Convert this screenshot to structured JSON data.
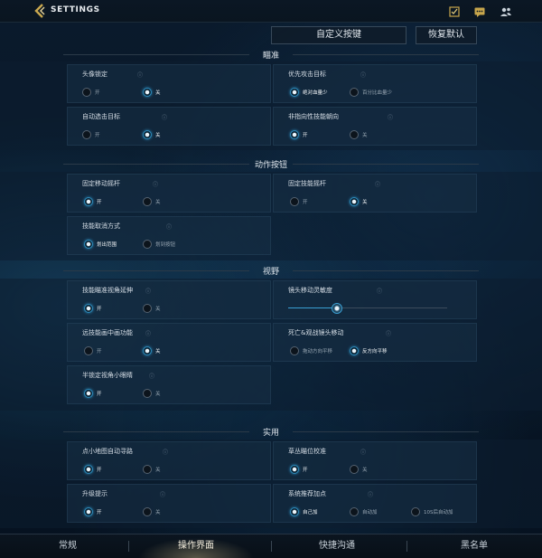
{
  "header": {
    "title": "SETTINGS",
    "icons": [
      "back-arrow-icon",
      "mission-icon",
      "chat-icon",
      "friends-icon"
    ]
  },
  "actions": {
    "custom_keys_label": "自定义按键",
    "reset_default_label": "恢复默认"
  },
  "sections": {
    "aim": {
      "title": "瞄准",
      "items": [
        {
          "label": "头像锁定",
          "options": [
            "开",
            "关"
          ],
          "selected": "关"
        },
        {
          "label": "优先攻击目标",
          "options": [
            "绝对血量少",
            "百分比血量少"
          ],
          "selected": "绝对血量少"
        },
        {
          "label": "自动选击目标",
          "options": [
            "开",
            "关"
          ],
          "selected": "关"
        },
        {
          "label": "非指向性技能朝向",
          "options": [
            "开",
            "关"
          ],
          "selected": "开"
        }
      ]
    },
    "action_buttons": {
      "title": "动作按钮",
      "items": [
        {
          "label": "固定移动摇杆",
          "options": [
            "开",
            "关"
          ],
          "selected": "开"
        },
        {
          "label": "固定技能摇杆",
          "options": [
            "开",
            "关"
          ],
          "selected": "关"
        },
        {
          "label": "技能取消方式",
          "options": [
            "划出范围",
            "划到按钮"
          ],
          "selected": "划出范围"
        }
      ]
    },
    "view": {
      "title": "视野",
      "items": [
        {
          "label": "技能瞄准视角延伸",
          "options": [
            "开",
            "关"
          ],
          "selected": "开"
        },
        {
          "label": "镜头移动灵敏度",
          "slider_value": 0.3
        },
        {
          "label": "远技能画中画功能",
          "options": [
            "开",
            "关"
          ],
          "selected": "关"
        },
        {
          "label": "死亡&观战镜头移动",
          "options": [
            "拖动方向平移",
            "反方向平移"
          ],
          "selected": "反方向平移"
        },
        {
          "label": "半锁定视角小眼睛",
          "options": [
            "开",
            "关"
          ],
          "selected": "开"
        }
      ]
    },
    "practical": {
      "title": "实用",
      "items": [
        {
          "label": "点小地图自动寻路",
          "options": [
            "开",
            "关"
          ],
          "selected": "开"
        },
        {
          "label": "草丛瞄位校准",
          "options": [
            "开",
            "关"
          ],
          "selected": "开"
        },
        {
          "label": "升级提示",
          "options": [
            "开",
            "关"
          ],
          "selected": "开"
        },
        {
          "label": "系统推荐加点",
          "options": [
            "自己加",
            "自动加",
            "10S后自动加"
          ],
          "selected": "自己加"
        }
      ]
    }
  },
  "info_glyph": "ⓘ",
  "bottom_tabs": [
    {
      "label": "常规"
    },
    {
      "label": "操作界面",
      "active": true
    },
    {
      "label": "快捷沟通"
    },
    {
      "label": "黑名单"
    }
  ],
  "colors": {
    "accent": "#3aa0d4",
    "background": "#071526",
    "card": "#183046",
    "active_tab_glow": "#f0dca0"
  }
}
